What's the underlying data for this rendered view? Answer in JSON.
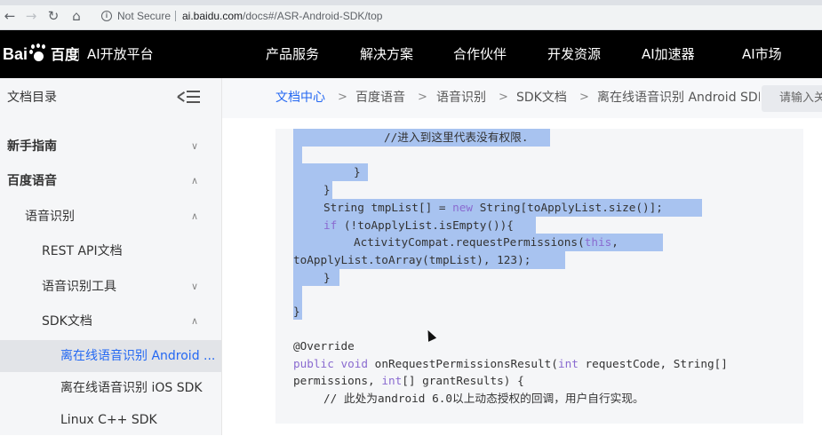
{
  "browser": {
    "security_label": "Not Secure",
    "url_host": "ai.baidu.com",
    "url_path": "/docs#/ASR-Android-SDK/top"
  },
  "header": {
    "logo_text_left": "Bai",
    "logo_text_right": "百度",
    "platform": "AI开放平台",
    "nav": [
      "产品服务",
      "解决方案",
      "合作伙伴",
      "开发资源",
      "AI加速器",
      "AI市场"
    ]
  },
  "sidebar": {
    "title": "文档目录",
    "items": [
      {
        "label": "新手指南",
        "chevron": "down"
      },
      {
        "label": "百度语音",
        "chevron": "up"
      },
      {
        "label": "语音识别",
        "chevron": "up"
      },
      {
        "label": "REST API文档",
        "chevron": ""
      },
      {
        "label": "语音识别工具",
        "chevron": "down"
      },
      {
        "label": "SDK文档",
        "chevron": "up"
      },
      {
        "label": "离在线语音识别 Android ...",
        "chevron": ""
      },
      {
        "label": "离在线语音识别 iOS SDK",
        "chevron": ""
      },
      {
        "label": "Linux C++ SDK",
        "chevron": ""
      }
    ]
  },
  "breadcrumb": [
    "文档中心",
    "百度语音",
    "语音识别",
    "SDK文档",
    "离在线语音识别 Android SDK"
  ],
  "search": {
    "placeholder": "请输入关"
  },
  "code": {
    "line1": "//进入到这里代表没有权限.",
    "line2": "}",
    "line3": "}",
    "line4a": "String tmpList[] = ",
    "line4b": "new",
    "line4c": " String[toApplyList.size()];",
    "line5a": "if",
    "line5b": " (!toApplyList.isEmpty()){",
    "line6a": "ActivityCompat.requestPermissions(",
    "line6b": "this",
    "line6c": ",",
    "line7": "toApplyList.toArray(tmpList), 123);",
    "line8": "}",
    "line9": "}",
    "line10": "@Override",
    "line11a": "public",
    "line11b": " ",
    "line11c": "void",
    "line11d": " onRequestPermissionsResult(",
    "line11e": "int",
    "line11f": " requestCode, String[]",
    "line12a": "permissions, ",
    "line12b": "int",
    "line12c": "[] grantResults) {",
    "line13": "// 此处为android 6.0以上动态授权的回调，用户自行实现。"
  }
}
